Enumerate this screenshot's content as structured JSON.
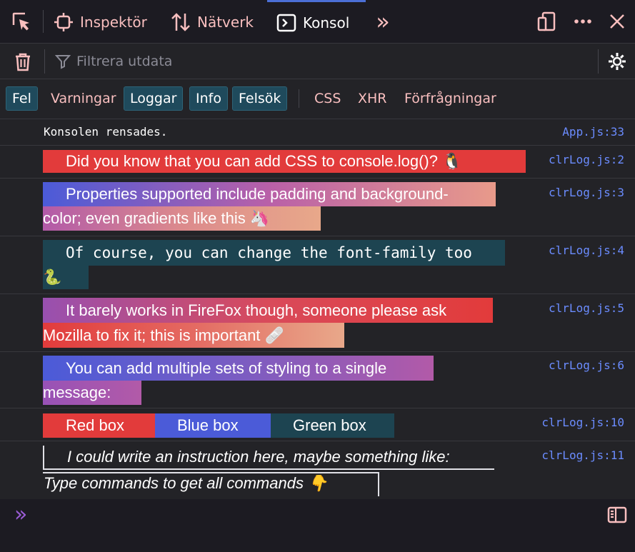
{
  "toolbar": {
    "tabs": [
      {
        "label": "Inspektör",
        "icon": "inspector-icon"
      },
      {
        "label": "Nätverk",
        "icon": "network-icon"
      },
      {
        "label": "Konsol",
        "icon": "console-icon"
      }
    ],
    "overflow_glyph": "»"
  },
  "filter": {
    "placeholder": "Filtrera utdata"
  },
  "levels": {
    "error": "Fel",
    "warnings": "Varningar",
    "logs": "Loggar",
    "info": "Info",
    "debug": "Felsök",
    "css": "CSS",
    "xhr": "XHR",
    "requests": "Förfrågningar"
  },
  "messages": {
    "m0": {
      "text": "Konsolen rensades.",
      "loc": "App.js:33"
    },
    "m1": {
      "text": "Did you know that you can add CSS to console.log()? 🐧",
      "loc": "clrLog.js:2"
    },
    "m2": {
      "line1": "Properties supported include padding and background-",
      "line2": "color; even gradients like this 🦄",
      "loc": "clrLog.js:3"
    },
    "m3": {
      "line1": "Of course, you can change the font-family too",
      "line2": "🐍",
      "loc": "clrLog.js:4"
    },
    "m4": {
      "line1": "It barely works in FireFox though, someone please ask",
      "line2": "Mozilla to fix it; this is important 🩹",
      "loc": "clrLog.js:5"
    },
    "m5": {
      "line1": "You can add multiple sets of styling to a single",
      "line2": "message:",
      "loc": "clrLog.js:6"
    },
    "m6": {
      "red": "Red box",
      "blue": "Blue box",
      "green": "Green box",
      "loc": "clrLog.js:10"
    },
    "m7": {
      "line1": "I could write an instruction here, maybe something like:",
      "line2": "Type commands to get all commands 👇",
      "loc": "clrLog.js:11"
    }
  },
  "prompt": {
    "glyph": "»"
  },
  "colors": {
    "accent": "#4b6fd6",
    "location": "#6b8cff",
    "active_filter": "#1f4a5c",
    "red": "#e23b3b",
    "blue": "#4b5bd8",
    "teal": "#1d4451"
  }
}
